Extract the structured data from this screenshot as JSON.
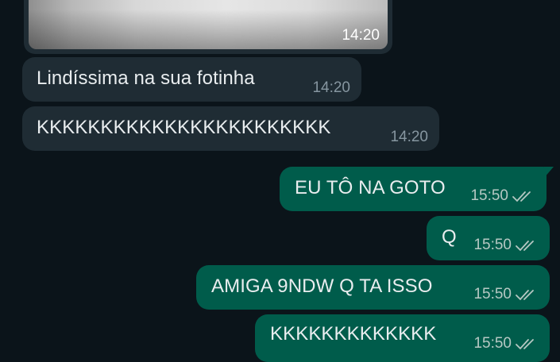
{
  "media_message": {
    "time": "14:20"
  },
  "messages": [
    {
      "direction": "in",
      "text": "Lindíssima na sua fotinha",
      "time": "14:20"
    },
    {
      "direction": "in",
      "text": "KKKKKKKKKKKKKKKKKKKKKKK",
      "time": "14:20"
    },
    {
      "direction": "out",
      "text": "EU TÔ NA GOTO",
      "time": "15:50",
      "status_icon": "double-check-icon"
    },
    {
      "direction": "out",
      "text": "Q",
      "time": "15:50",
      "status_icon": "double-check-icon"
    },
    {
      "direction": "out",
      "text": "AMIGA 9NDW Q TA ISSO",
      "time": "15:50",
      "status_icon": "double-check-icon"
    },
    {
      "direction": "out",
      "text": "KKKKKKKKKKKKK",
      "time": "15:50",
      "status_icon": "double-check-icon"
    }
  ],
  "colors": {
    "background": "#0b141a",
    "incoming_bubble": "#1f2c34",
    "outgoing_bubble": "#005c4b",
    "text": "#e9edef",
    "meta_in": "#8696a0",
    "meta_out": "#b6c8c3"
  }
}
